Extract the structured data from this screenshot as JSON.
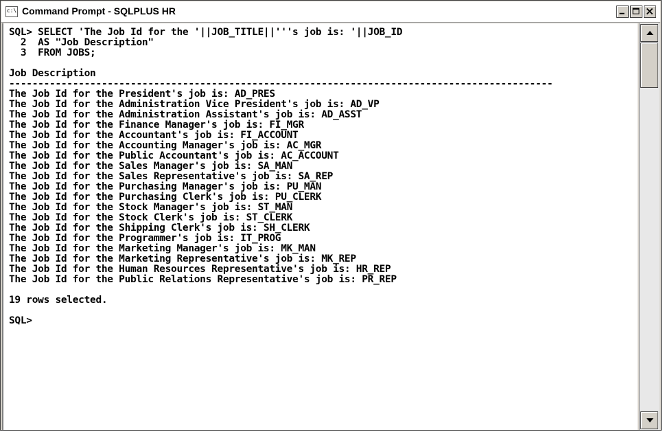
{
  "window": {
    "title": "Command Prompt - SQLPLUS HR",
    "icon_label": "c:\\",
    "controls": [
      "minimize",
      "maximize",
      "close"
    ]
  },
  "console": {
    "lines": [
      "SQL> SELECT 'The Job Id for the '||JOB_TITLE||'''s job is: '||JOB_ID",
      "  2  AS \"Job Description\"",
      "  3  FROM JOBS;",
      "",
      "Job Description",
      "----------------------------------------------------------------------------------------------",
      "The Job Id for the President's job is: AD_PRES",
      "The Job Id for the Administration Vice President's job is: AD_VP",
      "The Job Id for the Administration Assistant's job is: AD_ASST",
      "The Job Id for the Finance Manager's job is: FI_MGR",
      "The Job Id for the Accountant's job is: FI_ACCOUNT",
      "The Job Id for the Accounting Manager's job is: AC_MGR",
      "The Job Id for the Public Accountant's job is: AC_ACCOUNT",
      "The Job Id for the Sales Manager's job is: SA_MAN",
      "The Job Id for the Sales Representative's job is: SA_REP",
      "The Job Id for the Purchasing Manager's job is: PU_MAN",
      "The Job Id for the Purchasing Clerk's job is: PU_CLERK",
      "The Job Id for the Stock Manager's job is: ST_MAN",
      "The Job Id for the Stock Clerk's job is: ST_CLERK",
      "The Job Id for the Shipping Clerk's job is: SH_CLERK",
      "The Job Id for the Programmer's job is: IT_PROG",
      "The Job Id for the Marketing Manager's job is: MK_MAN",
      "The Job Id for the Marketing Representative's job is: MK_REP",
      "The Job Id for the Human Resources Representative's job is: HR_REP",
      "The Job Id for the Public Relations Representative's job is: PR_REP",
      "",
      "19 rows selected.",
      "",
      "SQL>"
    ]
  },
  "colors": {
    "console_background": "#ffffff",
    "console_text": "#000000",
    "chrome": "#d4d0c8"
  }
}
